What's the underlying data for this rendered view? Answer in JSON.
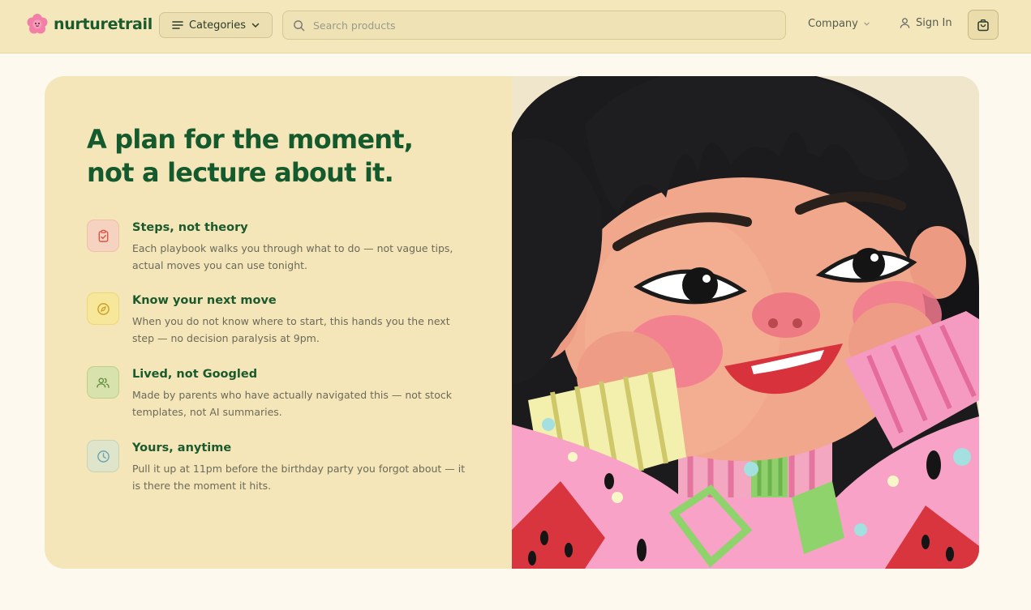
{
  "header": {
    "brand": "nurturetrail",
    "categories_label": "Categories",
    "search_placeholder": "Search products",
    "company_label": "Company",
    "signin_label": "Sign In"
  },
  "hero": {
    "headline": "A plan for the moment, not a lecture about it.",
    "features": [
      {
        "title": "Steps, not theory",
        "description": "Each playbook walks you through what to do — not vague tips, actual moves you can use tonight.",
        "icon": "clipboard-icon",
        "icon_bg": "#f6d3c0",
        "icon_color": "#d9564a"
      },
      {
        "title": "Know your next move",
        "description": "When you do not know where to start, this hands you the next step — no decision paralysis at 9pm.",
        "icon": "compass-icon",
        "icon_bg": "#f7e79a",
        "icon_color": "#c9a023"
      },
      {
        "title": "Lived, not Googled",
        "description": "Made by parents who have actually navigated this — not stock templates, not AI summaries.",
        "icon": "users-icon",
        "icon_bg": "#d7e2ad",
        "icon_color": "#5b8a3a"
      },
      {
        "title": "Yours, anytime",
        "description": "Pull it up at 11pm before the birthday party you forgot about — it is there the moment it hits.",
        "icon": "clock-icon",
        "icon_bg": "#dfe5cb",
        "icon_color": "#6ca3b0"
      }
    ]
  },
  "colors": {
    "brand_green": "#145a2c",
    "header_bg": "#f4e7bb",
    "card_bg": "#f5e6ba",
    "page_bg": "#fdf9ee"
  }
}
